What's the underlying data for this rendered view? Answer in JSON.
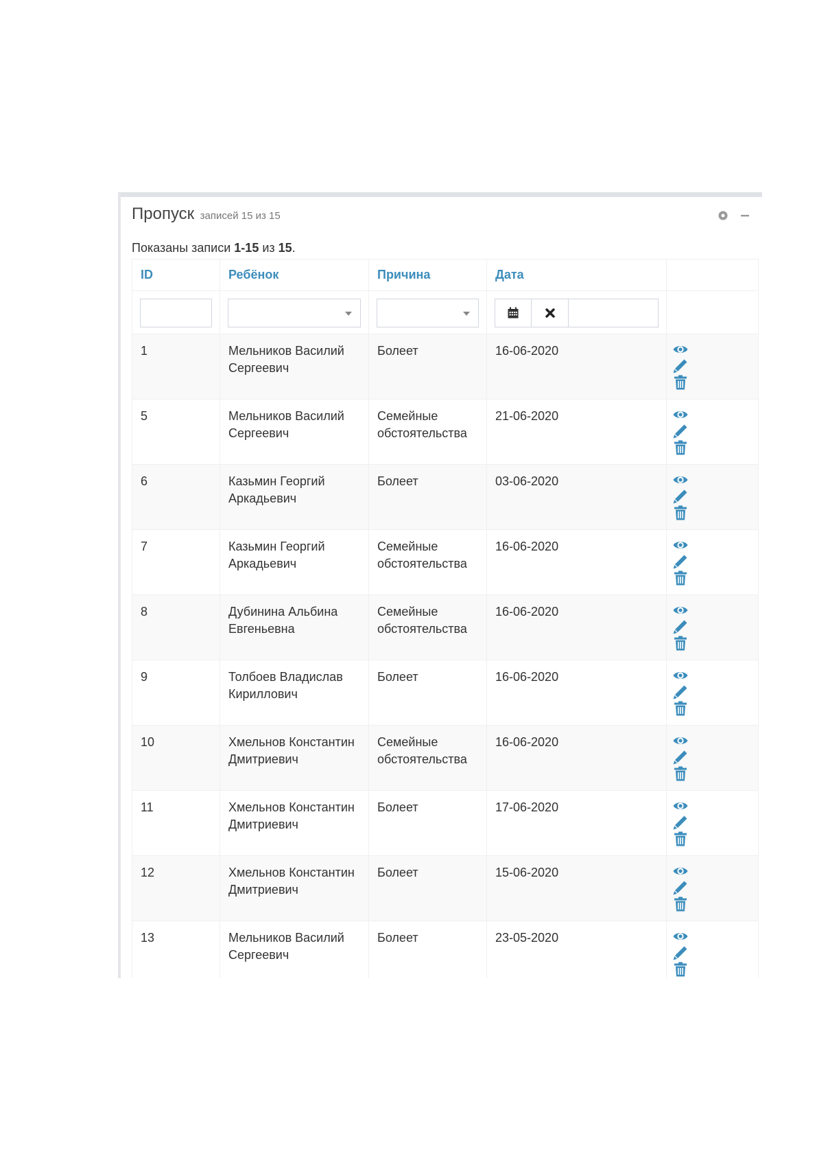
{
  "panel": {
    "title": "Пропуск",
    "subtitle": "записей 15 из 15"
  },
  "summary": {
    "prefix": "Показаны записи ",
    "range": "1-15",
    "middle": " из ",
    "total": "15",
    "suffix": "."
  },
  "columns": {
    "id": "ID",
    "child": "Ребёнок",
    "reason": "Причина",
    "date": "Дата"
  },
  "colors": {
    "link": "#3c8dbc",
    "row_stripe": "#f9f9f9"
  },
  "icons": {
    "collapse": "minus-icon",
    "settings": "circle-icon",
    "calendar": "calendar-icon",
    "clear": "close-icon",
    "view": "eye-icon",
    "edit": "pencil-icon",
    "delete": "trash-icon"
  },
  "rows": [
    {
      "id": "1",
      "child": "Мельников Василий Сергеевич",
      "reason": "Болеет",
      "date": "16-06-2020"
    },
    {
      "id": "5",
      "child": "Мельников Василий Сергеевич",
      "reason": "Семейные обстоятельства",
      "date": "21-06-2020"
    },
    {
      "id": "6",
      "child": "Казьмин Георгий Аркадьевич",
      "reason": "Болеет",
      "date": "03-06-2020"
    },
    {
      "id": "7",
      "child": "Казьмин Георгий Аркадьевич",
      "reason": "Семейные обстоятельства",
      "date": "16-06-2020"
    },
    {
      "id": "8",
      "child": "Дубинина Альбина Евгеньевна",
      "reason": "Семейные обстоятельства",
      "date": "16-06-2020"
    },
    {
      "id": "9",
      "child": "Толбоев Владислав Кириллович",
      "reason": "Болеет",
      "date": "16-06-2020"
    },
    {
      "id": "10",
      "child": "Хмельнов Константин Дмитриевич",
      "reason": "Семейные обстоятельства",
      "date": "16-06-2020"
    },
    {
      "id": "11",
      "child": "Хмельнов Константин Дмитриевич",
      "reason": "Болеет",
      "date": "17-06-2020"
    },
    {
      "id": "12",
      "child": "Хмельнов Константин Дмитриевич",
      "reason": "Болеет",
      "date": "15-06-2020"
    },
    {
      "id": "13",
      "child": "Мельников Василий Сергеевич",
      "reason": "Болеет",
      "date": "23-05-2020"
    }
  ]
}
